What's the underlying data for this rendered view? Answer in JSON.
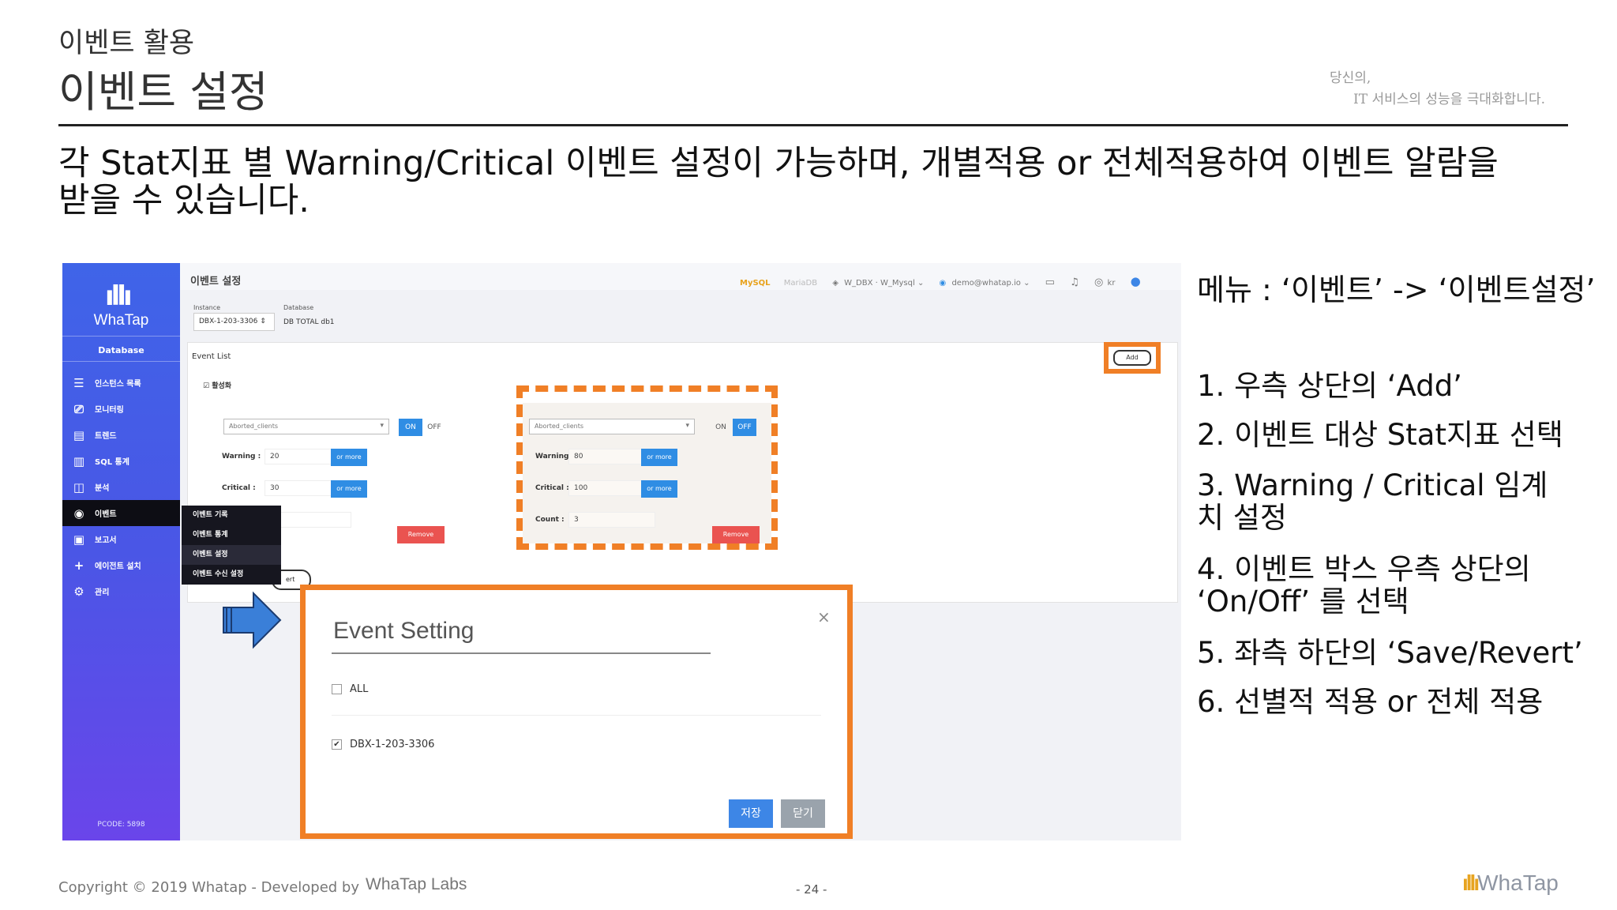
{
  "slide": {
    "subtitle": "이벤트 활용",
    "title": "이벤트 설정",
    "tagline_1": "당신의,",
    "tagline_2": "IT 서비스의 성능을 극대화합니다.",
    "description_1": "각 Stat지표 별 Warning/Critical 이벤트 설정이 가능하며, 개별적용 or 전체적용하여 이벤트 알람을",
    "description_2": "받을 수 있습니다."
  },
  "screenshot": {
    "logo_bars": "ıllı",
    "logo_text": "WhaTap",
    "sidebar_category": "Database",
    "sidebar_items": [
      {
        "icon": "list-icon",
        "glyph": "☰",
        "label": "인스턴스 목록"
      },
      {
        "icon": "monitor-icon",
        "glyph": "⎚",
        "label": "모니터링"
      },
      {
        "icon": "calendar-icon",
        "glyph": "▤",
        "label": "트렌드"
      },
      {
        "icon": "bar-chart-icon",
        "glyph": "▥",
        "label": "SQL 통계"
      },
      {
        "icon": "analysis-icon",
        "glyph": "◫",
        "label": "분석"
      },
      {
        "icon": "event-icon",
        "glyph": "◉",
        "label": "이벤트"
      },
      {
        "icon": "report-icon",
        "glyph": "▣",
        "label": "보고서"
      },
      {
        "icon": "plus-icon",
        "glyph": "+",
        "label": "에이전트 설치"
      },
      {
        "icon": "gear-icon",
        "glyph": "⚙",
        "label": "관리"
      }
    ],
    "flyout_items": [
      "이벤트 기록",
      "이벤트 통계",
      "이벤트 설정",
      "이벤트 수신 설정"
    ],
    "pcode": "PCODE: 5898",
    "page_title": "이벤트 설정",
    "header_mysql": "MySQL",
    "header_mariadb": "MariaDB",
    "header_project": "W_DBX · W_Mysql ⌄",
    "header_user": "demo@whatap.io ⌄",
    "header_lang": "kr",
    "instance_label": "Instance",
    "instance_value": "DBX-1-203-3306 ⇕",
    "database_label": "Database",
    "database_value": "DB TOTAL db1",
    "event_list_label": "Event List",
    "active_label": "활성화",
    "add_button": "Add",
    "box_left": {
      "stat": "Aborted_clients",
      "on": "ON",
      "off": "OFF",
      "warning_label": "Warning :",
      "warning_value": "20",
      "critical_label": "Critical :",
      "critical_value": "30",
      "or_more": "or more",
      "remove": "Remove"
    },
    "box_right": {
      "stat": "Aborted_clients",
      "on": "ON",
      "off": "OFF",
      "warning_label": "Warning :",
      "warning_value": "80",
      "critical_label": "Critical :",
      "critical_value": "100",
      "count_label": "Count :",
      "count_value": "3",
      "or_more": "or more",
      "remove": "Remove"
    },
    "revert_fragment": "ert",
    "modal": {
      "title": "Event Setting",
      "close": "×",
      "all_label": "ALL",
      "instance_label": "DBX-1-203-3306",
      "check_mark": "✔",
      "save": "저장",
      "close_button": "닫기"
    }
  },
  "steps": {
    "menu_path": "메뉴 : ‘이벤트’ -> ‘이벤트설정’",
    "items": [
      "1. 우측 상단의 ‘Add’",
      "2. 이벤트 대상 Stat지표 선택",
      "3. Warning / Critical 임계치 설정",
      "4. 이벤트 박스 우측 상단의 ‘On/Off’ 를 선택",
      "5. 좌측 하단의 ‘Save/Revert’",
      "6. 선별적 적용 or 전체 적용"
    ]
  },
  "footer": {
    "copyright": "Copyright © 2019 Whatap - Developed by",
    "labs": "WhaTap Labs",
    "page_number": "- 24 -",
    "logo_bars": "ıllı",
    "logo_text": "WhaTap"
  },
  "colors": {
    "highlight_orange": "#f07f26",
    "sidebar_blue": "#4a56e6",
    "button_blue": "#2f8de4",
    "remove_red": "#ea5350"
  }
}
